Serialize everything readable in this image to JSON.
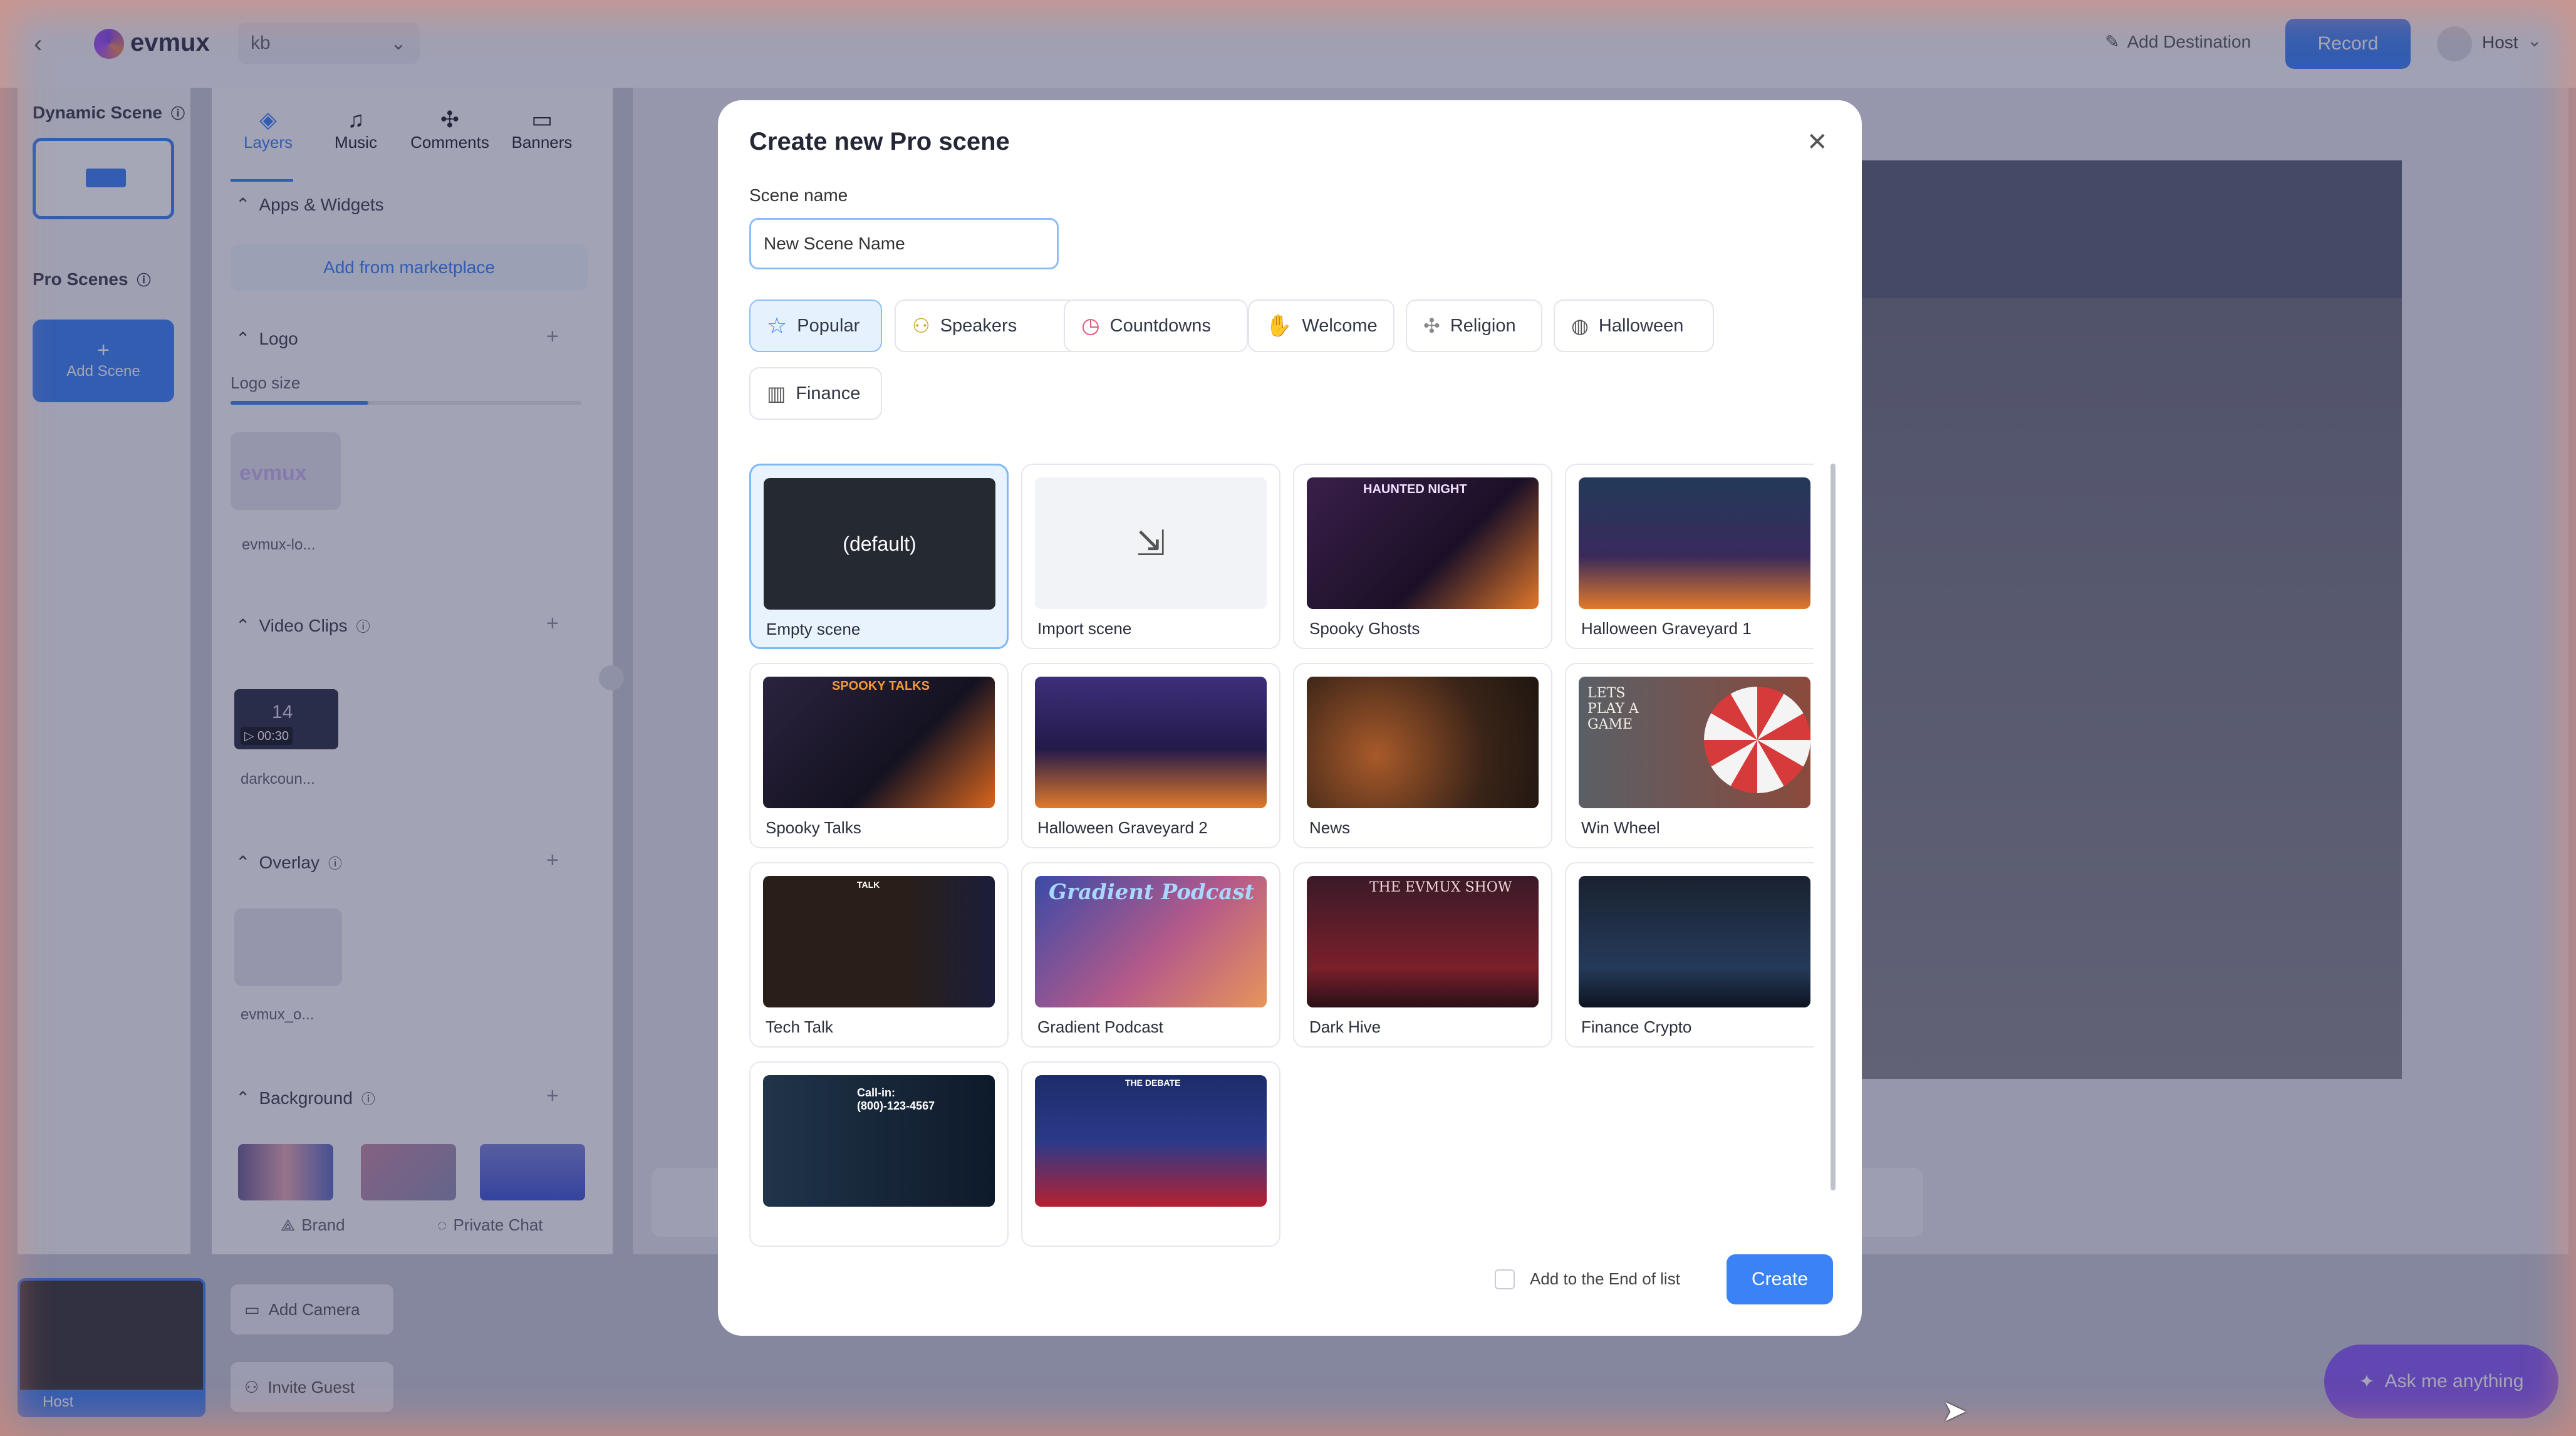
{
  "app": {
    "brand": "evmux",
    "workspace": "kb"
  },
  "topbar": {
    "add_destination": "Add Destination",
    "record": "Record",
    "user": "Host"
  },
  "left": {
    "dynamic_scene": "Dynamic Scene",
    "pro_scenes": "Pro Scenes",
    "add_scene_plus": "+",
    "add_scene": "Add Scene",
    "self_label": "Host"
  },
  "panel": {
    "tabs": [
      "Layers",
      "Music",
      "Comments",
      "Banners"
    ],
    "apps_widgets": "Apps & Widgets",
    "add_marketplace": "Add from marketplace",
    "logo": "Logo",
    "logo_size": "Logo size",
    "logo_thumb": "evmux-lo...",
    "logo_thumb_text": "evmux",
    "video_clips": "Video Clips",
    "video_duration": "▷ 00:30",
    "video_digits": "14",
    "video_thumb": "darkcoun...",
    "overlay": "Overlay",
    "overlay_thumb": "evmux_o...",
    "background": "Background",
    "brand": "Brand",
    "private_chat": "Private Chat"
  },
  "bottom": {
    "add_camera": "Add Camera",
    "invite_guest": "Invite Guest",
    "ask": "Ask me anything"
  },
  "modal": {
    "title": "Create new Pro scene",
    "scene_name_label": "Scene name",
    "scene_name_value": "New Scene Name",
    "categories": [
      "Popular",
      "Speakers",
      "Countdowns",
      "Welcome",
      "Religion",
      "Halloween",
      "Finance"
    ],
    "active_category": "Popular",
    "templates": [
      {
        "name": "Empty scene",
        "thumb_text": "(default)"
      },
      {
        "name": "Import scene"
      },
      {
        "name": "Spooky Ghosts",
        "thumb_text": "HAUNTED NIGHT"
      },
      {
        "name": "Halloween Graveyard 1"
      },
      {
        "name": "Spooky Talks",
        "thumb_text": "SPOOKY TALKS"
      },
      {
        "name": "Halloween Graveyard 2"
      },
      {
        "name": "News"
      },
      {
        "name": "Win Wheel",
        "thumb_text": "LETS PLAY A GAME"
      },
      {
        "name": "Tech Talk",
        "thumb_text": "TALK"
      },
      {
        "name": "Gradient Podcast",
        "thumb_text": "Gradient Podcast"
      },
      {
        "name": "Dark Hive",
        "thumb_text": "THE EVMUX SHOW"
      },
      {
        "name": "Finance Crypto"
      },
      {
        "name": "",
        "thumb_text": "Call-in: (800)-123-4567"
      },
      {
        "name": "",
        "thumb_text": "THE DEBATE"
      }
    ],
    "add_end_label": "Add to the End of list",
    "create": "Create"
  },
  "colors": {
    "accent": "#3b82f6",
    "record": "#3b82f6",
    "ask": "#8b5cf6"
  }
}
